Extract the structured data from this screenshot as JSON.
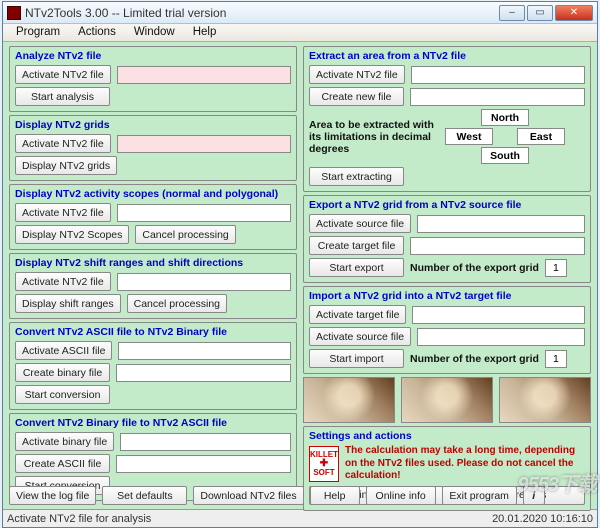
{
  "window": {
    "title": "NTv2Tools 3.00 -- Limited trial version",
    "min": "–",
    "max": "▭",
    "close": "✕"
  },
  "menu": {
    "program": "Program",
    "actions": "Actions",
    "window": "Window",
    "help": "Help"
  },
  "left": {
    "analyze": {
      "title": "Analyze NTv2 file",
      "activate": "Activate NTv2 file",
      "start": "Start analysis"
    },
    "display_grids": {
      "title": "Display NTv2 grids",
      "activate": "Activate NTv2 file",
      "display": "Display NTv2 grids"
    },
    "activity_scopes": {
      "title": "Display NTv2 activity scopes (normal and polygonal)",
      "activate": "Activate NTv2 file",
      "display": "Display NTv2 Scopes",
      "cancel": "Cancel processing"
    },
    "shift_ranges": {
      "title": "Display NTv2 shift ranges and shift directions",
      "activate": "Activate NTv2 file",
      "display": "Display shift ranges",
      "cancel": "Cancel processing"
    },
    "ascii_to_binary": {
      "title": "Convert NTv2 ASCII file to NTv2 Binary file",
      "activate": "Activate ASCII file",
      "create": "Create binary file",
      "start": "Start conversion"
    },
    "binary_to_ascii": {
      "title": "Convert NTv2 Binary file to NTv2 ASCII file",
      "activate": "Activate binary file",
      "create": "Create ASCII file",
      "start": "Start conversion"
    }
  },
  "right": {
    "extract": {
      "title": "Extract an area from a NTv2 file",
      "activate": "Activate NTv2 file",
      "create": "Create new file",
      "area_label": "Area to be extracted with its limitations in decimal degrees",
      "start": "Start extracting",
      "north": "North",
      "south": "South",
      "west": "West",
      "east": "East"
    },
    "export": {
      "title": "Export a NTv2 grid from a NTv2 source file",
      "source": "Activate source file",
      "target": "Create target file",
      "start": "Start export",
      "num_label": "Number of the export grid",
      "num_value": "1"
    },
    "import": {
      "title": "Import a NTv2 grid into a NTv2 target file",
      "target": "Activate target file",
      "source": "Activate source file",
      "start": "Start import",
      "num_label": "Number of the export grid",
      "num_value": "1"
    },
    "settings": {
      "title": "Settings and actions",
      "logo1": "KILLET",
      "logo2": "SOFT",
      "warning": "The calculation may take a long time, depending on the NTv2 files used. Please do not cancel the calculation!",
      "print": "Print results",
      "save": "Save results"
    }
  },
  "bottom": {
    "view_log": "View the log file",
    "set_defaults": "Set defaults",
    "download": "Download NTv2 files",
    "help": "Help",
    "online": "Online info",
    "exit": "Exit program",
    "info": "i"
  },
  "status": {
    "text": "Activate NTv2 file for analysis",
    "time": "20.01.2020 10:16:10"
  },
  "watermark": "9553下载"
}
